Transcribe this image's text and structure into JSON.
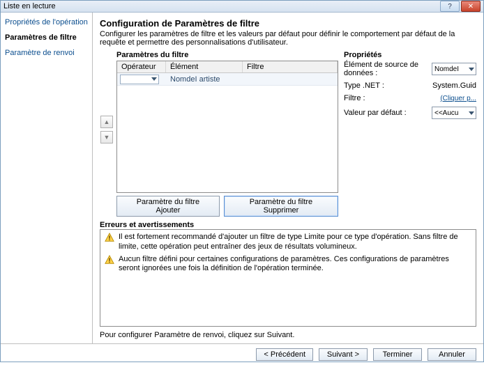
{
  "window": {
    "title": "Liste en lecture"
  },
  "sidebar": {
    "items": [
      {
        "label": "Propriétés de l'opération"
      },
      {
        "label": "Paramètres de filtre"
      },
      {
        "label": "Paramètre de renvoi"
      }
    ]
  },
  "main": {
    "heading": "Configuration de Paramètres de filtre",
    "description": "Configurer les paramètres de filtre et les valeurs par défaut pour définir le comportement par défaut de la requête et permettre des personnalisations d'utilisateur."
  },
  "filters": {
    "section_label": "Paramètres du filtre",
    "columns": {
      "operator": "Opérateur",
      "element": "Élément",
      "filter": "Filtre"
    },
    "rows": [
      {
        "operator": "",
        "element": "NomdeI artiste",
        "filter": ""
      }
    ],
    "buttons": {
      "add": "Paramètre du filtre Ajouter",
      "remove": "Paramètre du filtre Supprimer"
    }
  },
  "properties": {
    "section_label": "Propriétés",
    "data_source_label": "Élément de source de données :",
    "data_source_value": "NomdeI",
    "type_label": "Type .NET :",
    "type_value": "System.Guid",
    "filter_label": "Filtre :",
    "filter_link": "(Cliquer p...",
    "default_label": "Valeur par défaut :",
    "default_value": "<<Aucu"
  },
  "warnings": {
    "section_label": "Erreurs et avertissements",
    "items": [
      "Il est fortement recommandé d'ajouter un filtre de type Limite pour ce type d'opération. Sans filtre de limite, cette opération peut entraîner des jeux de résultats volumineux.",
      "Aucun filtre défini pour certaines configurations de paramètres. Ces configurations de paramètres seront ignorées une fois la définition de l'opération terminée."
    ]
  },
  "hint": "Pour configurer Paramètre de renvoi, cliquez sur Suivant.",
  "footer": {
    "back": "< Précédent",
    "next": "Suivant >",
    "finish": "Terminer",
    "cancel": "Annuler"
  }
}
